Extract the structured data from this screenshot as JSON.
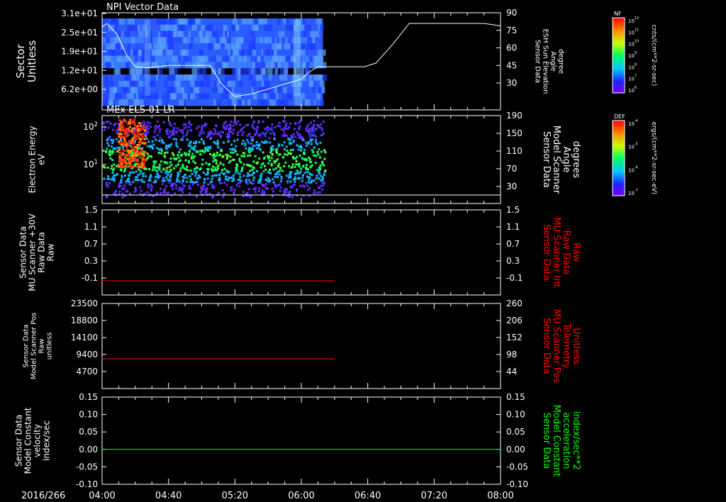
{
  "date_label": "2016/266",
  "time_ticks": [
    "04:00",
    "04:40",
    "05:20",
    "06:00",
    "06:40",
    "07:20",
    "08:00"
  ],
  "colors": {
    "white": "#ffffff",
    "red": "#ff0000",
    "green": "#00ff00",
    "black": "#000000"
  },
  "colorbars": [
    {
      "label": "NF",
      "unit": "cnts/(cm**2-sr-sec)",
      "ticks": [
        "10^12",
        "10^11",
        "10^10",
        "10^9",
        "10^8",
        "10^7",
        "10^6"
      ]
    },
    {
      "label": "DEF",
      "unit": "ergs/(cm**2-sr-sec-eV)",
      "ticks": [
        "10^-4",
        "10^-5",
        "10^-6",
        "10^-7"
      ]
    }
  ],
  "chart_data": [
    {
      "type": "heatmap",
      "title": "NPI Vector Data",
      "ylabel_lines": [
        "Sector",
        "Unitless"
      ],
      "yticks": [
        "3.1e+01",
        "2.5e+01",
        "1.9e+01",
        "1.2e+01",
        "6.2e+00"
      ],
      "y2label_lines": [
        "Sensor Data",
        "ESH Sun Elevation",
        "Angle",
        "degree"
      ],
      "y2ticks": [
        "90",
        "75",
        "60",
        "45",
        "30"
      ],
      "data_time_range": [
        "04:00",
        "06:13"
      ],
      "overlay_series": {
        "name": "ESH Sun Elevation Angle",
        "x": [
          "04:00",
          "04:03",
          "04:09",
          "04:15",
          "04:20",
          "04:27",
          "04:40",
          "04:50",
          "05:00",
          "05:05",
          "05:12",
          "05:20",
          "05:30",
          "05:50",
          "06:00",
          "06:05",
          "06:10",
          "06:30",
          "06:38",
          "06:45",
          "06:55",
          "07:05",
          "07:25",
          "07:50",
          "08:00"
        ],
        "y": [
          79,
          82,
          73,
          56,
          47,
          46,
          48,
          48,
          48,
          48,
          33,
          23,
          25,
          33,
          37,
          43,
          47,
          47,
          47,
          50,
          65,
          82,
          82,
          82,
          80
        ]
      }
    },
    {
      "type": "heatmap",
      "title": "MEx ELS-01 LR",
      "ylabel_lines": [
        "Electron Energy",
        "eV"
      ],
      "yticks": [
        "10^2",
        "10^1"
      ],
      "y2label_lines": [
        "Sensor Data",
        "Model Scanner",
        "Angle",
        "degrees"
      ],
      "y2ticks": [
        "190",
        "150",
        "110",
        "70",
        "30"
      ],
      "data_time_range": [
        "04:00",
        "06:14"
      ],
      "overlay_series": {
        "name": "Model Scanner Angle",
        "x": [
          "04:00",
          "08:00"
        ],
        "y": [
          10,
          10
        ]
      }
    },
    {
      "type": "line",
      "ylabel_lines": [
        "Sensor Data",
        "MU Scanner +30V",
        "Raw Data",
        "Raw"
      ],
      "yticks": [
        "1.5",
        "1.1",
        "0.7",
        "0.3",
        "-0.1"
      ],
      "y2label_lines": [
        "Sensor Data",
        "MU Scanner Int",
        "Raw Data",
        "Raw"
      ],
      "y2ticks": [
        "1.5",
        "1.1",
        "0.7",
        "0.3",
        "-0.1"
      ],
      "ylim": [
        -0.3,
        1.5
      ],
      "series": [
        {
          "name": "",
          "color": "#ff0000",
          "x": [
            "04:00",
            "06:20"
          ],
          "y": [
            0.0,
            0.0
          ]
        }
      ]
    },
    {
      "type": "line",
      "ylabel_lines": [
        "Sensor Data",
        "Model Scanner Pos",
        "Raw",
        "unitless"
      ],
      "yticks": [
        "23500",
        "18800",
        "14100",
        "9400",
        "4700"
      ],
      "y2label_lines": [
        "Sensor Data",
        "MU Scanner Pos",
        "Telemetry",
        "Unitless"
      ],
      "y2ticks": [
        "260",
        "206",
        "152",
        "98",
        "44"
      ],
      "ylim": [
        0,
        23500
      ],
      "series": [
        {
          "name": "",
          "color": "#ff0000",
          "x": [
            "04:00",
            "06:20"
          ],
          "y": [
            8200,
            8200
          ]
        }
      ]
    },
    {
      "type": "line",
      "ylabel_lines": [
        "Sensor Data",
        "Model Constant",
        "velocity",
        "index/sec"
      ],
      "yticks": [
        "0.15",
        "0.10",
        "0.05",
        "0.00",
        "-0.05",
        "-0.10"
      ],
      "y2label_lines": [
        "Sensor Data",
        "Model Constant",
        "acceleration",
        "index/sec**2"
      ],
      "y2ticks": [
        "0.15",
        "0.10",
        "0.05",
        "0.00",
        "-0.05",
        "-0.10"
      ],
      "ylim": [
        -0.1,
        0.15
      ],
      "series": [
        {
          "name": "",
          "color": "#00ff00",
          "x": [
            "04:00",
            "08:00"
          ],
          "y": [
            0.0,
            0.0
          ]
        }
      ]
    }
  ]
}
